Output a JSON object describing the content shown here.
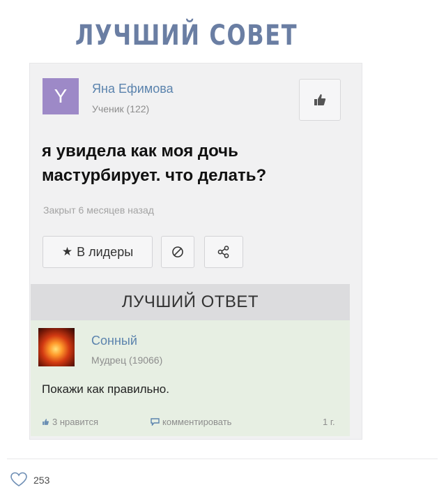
{
  "heading": "ЛУЧШИЙ СОВЕТ",
  "question": {
    "avatar_letter": "Y",
    "author_name": "Яна Ефимова",
    "author_rank": "Ученик (122)",
    "text": "я увидела как моя дочь мастурбирует. что делать?",
    "closed_text": "Закрыт 6 месяцев назад",
    "like_icon": "thumbs-up-icon"
  },
  "actions": {
    "leaders_label": "В лидеры",
    "leaders_icon": "star-icon",
    "block_icon": "block-icon",
    "share_icon": "share-icon"
  },
  "best_answer": {
    "header": "ЛУЧШИЙ ОТВЕТ",
    "author_name": "Сонный",
    "author_rank": "Мудрец (19066)",
    "text": "Покажи как правильно.",
    "likes_label": "3 нравится",
    "comment_label": "комментировать",
    "time": "1 г."
  },
  "post_footer": {
    "like_count": "253"
  },
  "colors": {
    "heading": "#6a7ea3",
    "link": "#5b83ad",
    "avatar_bg": "#9d89c7",
    "answer_bg": "#e7efe3",
    "best_header_bg": "#dcdcde"
  }
}
